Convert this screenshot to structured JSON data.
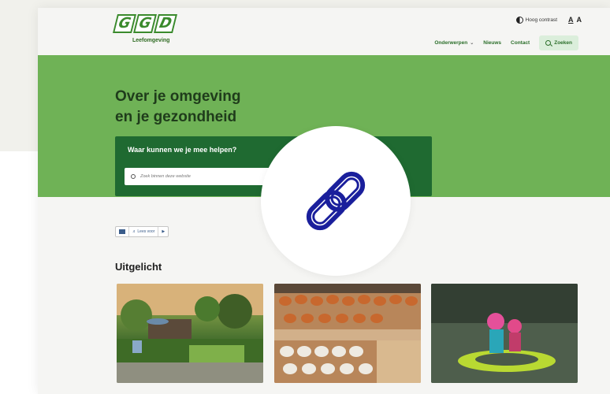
{
  "colors": {
    "brand_green": "#6fb256",
    "dark_green": "#1f6a31",
    "link_icon_blue": "#1a1f9c"
  },
  "header": {
    "logo_letters": [
      "G",
      "G",
      "D"
    ],
    "logo_subtitle": "Leefomgeving",
    "contrast_label": "Hoog contrast",
    "font_small": "A",
    "font_large": "A"
  },
  "nav": {
    "items": [
      {
        "label": "Onderwerpen",
        "icon": "chevron-down-icon"
      },
      {
        "label": "Nieuws"
      },
      {
        "label": "Contact"
      }
    ],
    "search_label": "Zoeken"
  },
  "hero": {
    "title_line1": "Over je omgeving",
    "title_line2": "en je gezondheid",
    "help_title": "Waar kunnen we je mee helpen?",
    "search_placeholder": "Zoek binnen deze website"
  },
  "readbar": {
    "read_label": "Lees voor"
  },
  "featured": {
    "title": "Uitgelicht"
  },
  "overlay": {
    "icon": "link-icon"
  }
}
